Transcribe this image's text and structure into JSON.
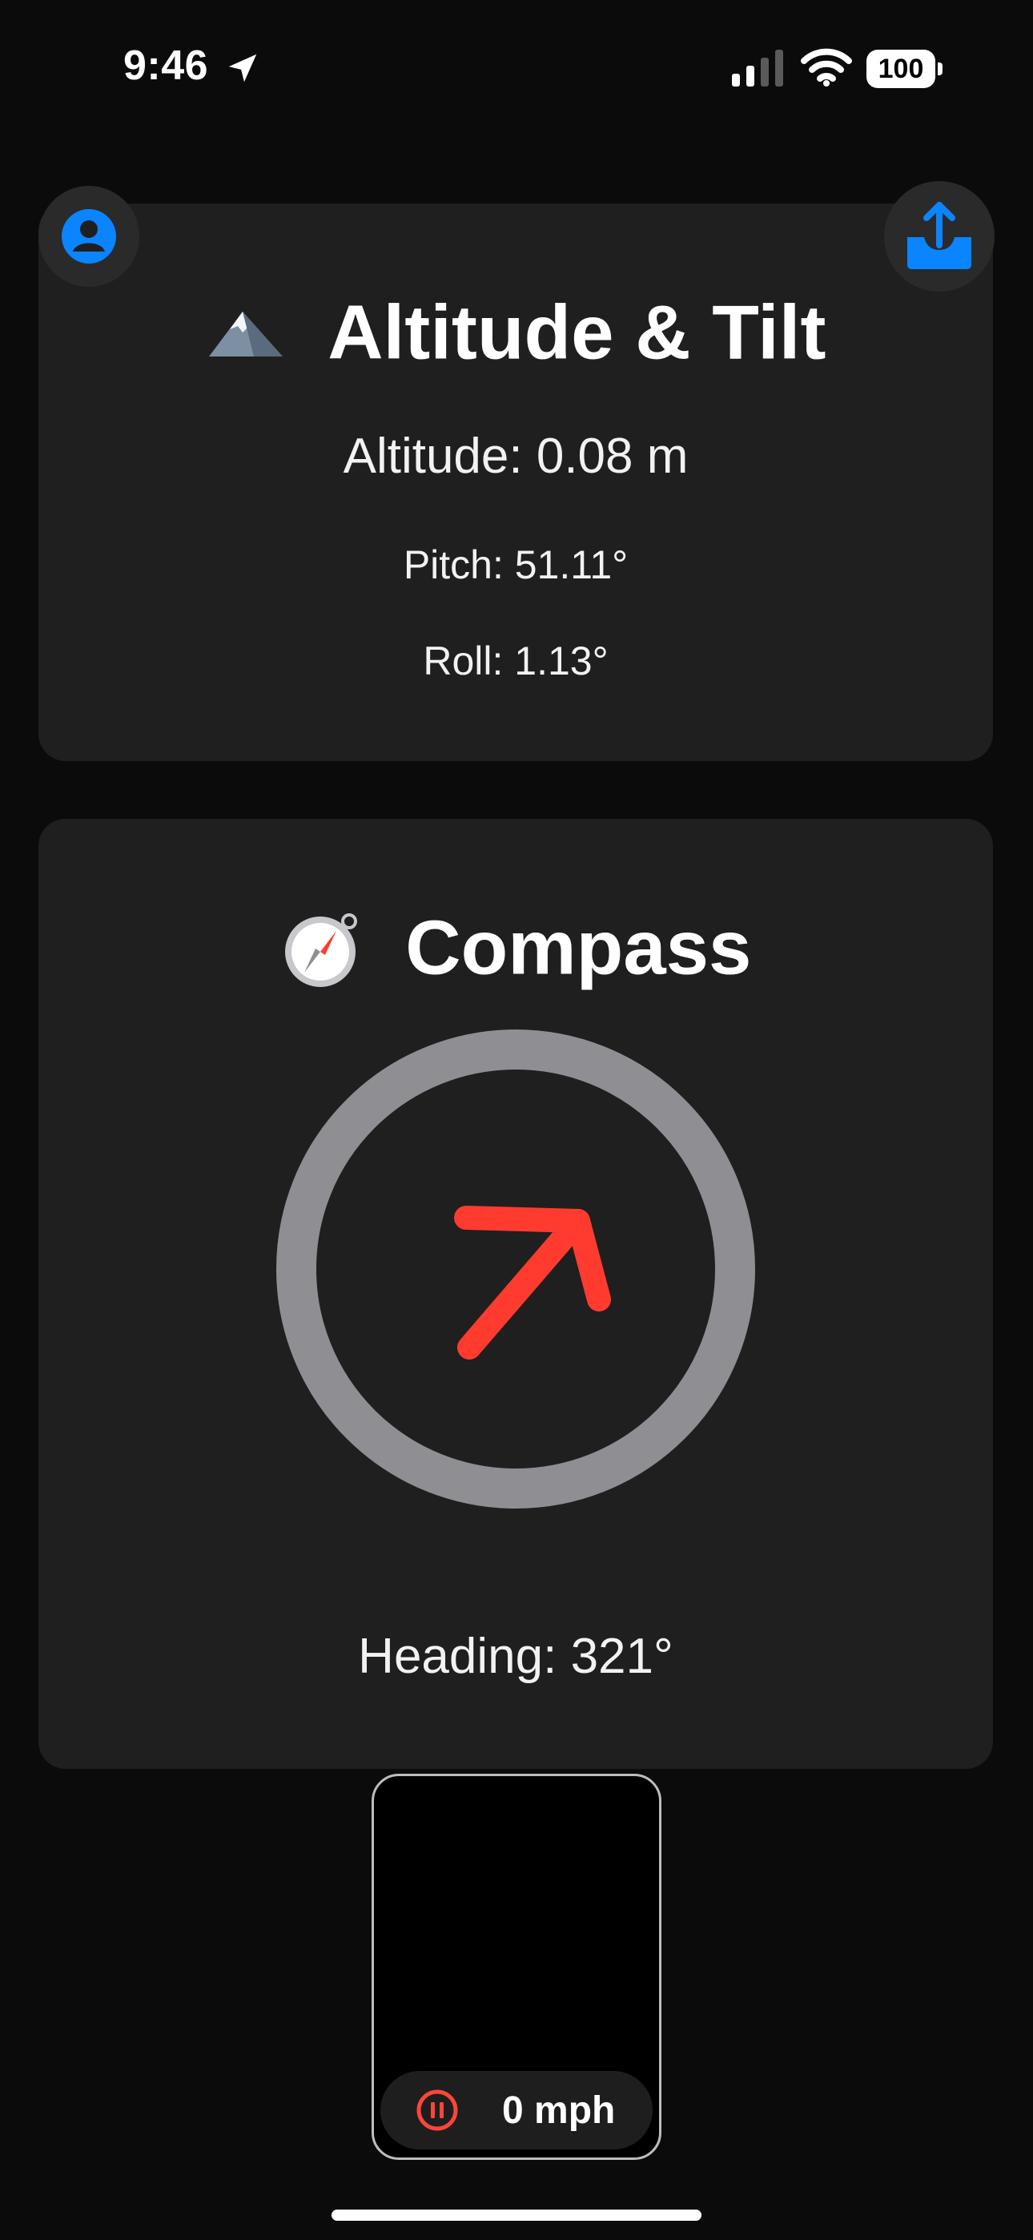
{
  "status_bar": {
    "time": "9:46",
    "battery": "100",
    "location_icon": "location-arrow-icon",
    "signal_icon": "signal-bars-icon",
    "wifi_icon": "wifi-icon",
    "battery_icon": "battery-icon"
  },
  "floating_buttons": {
    "profile_icon": "person-circle-icon",
    "share_icon": "tray-share-icon",
    "accent_color": "#0a84ff"
  },
  "altitude_card": {
    "emoji": "🗻",
    "title": "Altitude & Tilt",
    "altitude": "Altitude: 0.08 m",
    "pitch": "Pitch: 51.11°",
    "roll": "Roll: 1.13°"
  },
  "compass_card": {
    "emoji": "🧭",
    "title": "Compass",
    "heading": "Heading: 321°",
    "arrow_color": "#ff3b30",
    "ring_color": "#8e8e93"
  },
  "mini_player": {
    "speed": "0 mph",
    "pause_icon": "pause-circle-icon",
    "pause_color": "#ff453a"
  }
}
